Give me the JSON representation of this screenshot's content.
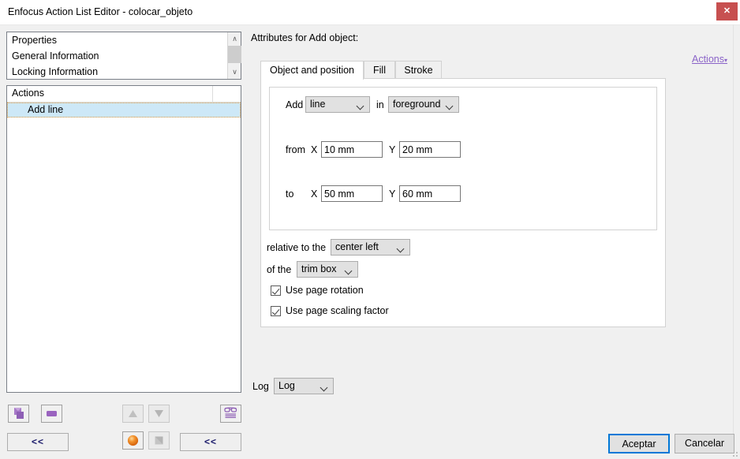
{
  "window": {
    "title": "Enfocus Action List Editor - colocar_objeto",
    "close_label": "✕",
    "accent_close": "#c75050"
  },
  "properties_panel": {
    "items": [
      {
        "label": "Properties"
      },
      {
        "label": "General Information"
      },
      {
        "label": "Locking Information"
      }
    ],
    "scroll_up": "∧",
    "scroll_down": "∨"
  },
  "actions_panel": {
    "header": "Actions",
    "rows": [
      {
        "label": "Add line",
        "selected": true
      }
    ]
  },
  "attributes": {
    "title": "Attributes for Add object:",
    "actions_link": "Actions",
    "actions_link_caret": "▾",
    "actions_link_color": "#8a63c8",
    "tabs": [
      {
        "label": "Object and position",
        "active": true
      },
      {
        "label": "Fill",
        "active": false
      },
      {
        "label": "Stroke",
        "active": false
      }
    ],
    "form": {
      "add_label": "Add",
      "add_value": "line",
      "in_label": "in",
      "in_value": "foreground",
      "from_label": "from",
      "from_x_label": "X",
      "from_x_value": "10 mm",
      "from_y_label": "Y",
      "from_y_value": "20 mm",
      "to_label": "to",
      "to_x_label": "X",
      "to_x_value": "50 mm",
      "to_y_label": "Y",
      "to_y_value": "60 mm",
      "relative_label": "relative to the",
      "relative_value": "center left",
      "of_the_label": "of the",
      "of_the_value": "trim box",
      "checkbox_rotation": "Use page rotation",
      "checkbox_scaling": "Use page scaling factor"
    },
    "log_label": "Log",
    "log_value": "Log"
  },
  "toolbar": {
    "add_icon": "add-shape-icon",
    "remove_icon": "remove-icon",
    "move_up_icon": "▲",
    "move_down_icon": "▼",
    "preview_icon": "glasses-icon",
    "collapse_left_label": "<<",
    "collapse_right_label": "<<",
    "sphere_icon": "orange-sphere-icon",
    "square_icon": "gray-square-icon"
  },
  "footer": {
    "accept_label": "Aceptar",
    "cancel_label": "Cancelar",
    "accent": "#0078d7"
  }
}
